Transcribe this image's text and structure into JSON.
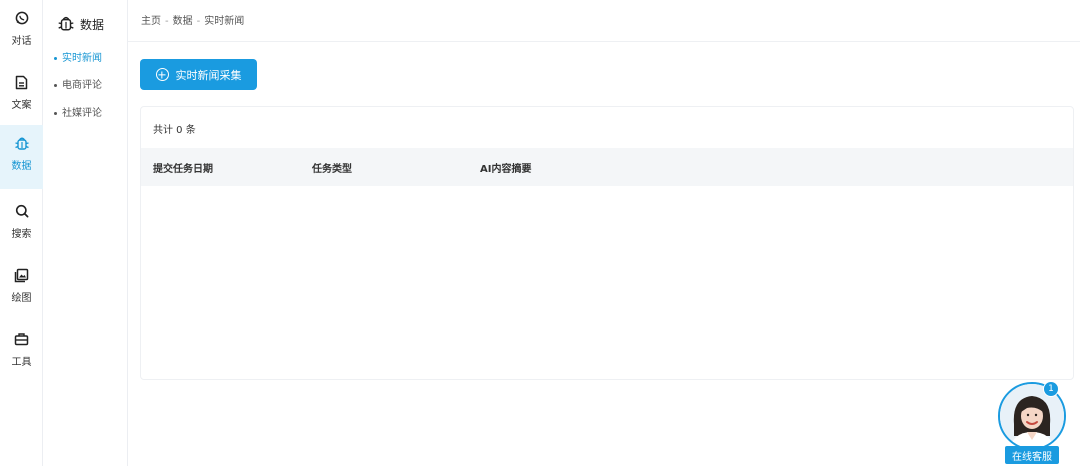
{
  "rail": {
    "items": [
      {
        "label": "对话",
        "icon": "chat-icon",
        "active": false
      },
      {
        "label": "文案",
        "icon": "document-icon",
        "active": false
      },
      {
        "label": "数据",
        "icon": "data-bug-icon",
        "active": true
      },
      {
        "label": "搜索",
        "icon": "search-icon",
        "active": false
      },
      {
        "label": "绘图",
        "icon": "image-icon",
        "active": false
      },
      {
        "label": "工具",
        "icon": "toolbox-icon",
        "active": false
      }
    ]
  },
  "submenu": {
    "title": "数据",
    "icon": "data-bug-icon",
    "items": [
      {
        "label": "实时新闻",
        "active": true
      },
      {
        "label": "电商评论",
        "active": false
      },
      {
        "label": "社媒评论",
        "active": false
      }
    ]
  },
  "breadcrumb": {
    "items": [
      "主页",
      "数据",
      "实时新闻"
    ],
    "separator": "-"
  },
  "toolbar": {
    "collect_button_label": "实时新闻采集",
    "collect_button_icon": "plus-circle-icon"
  },
  "table": {
    "count_text": "共计 0 条",
    "columns": [
      "提交任务日期",
      "任务类型",
      "AI内容摘要"
    ],
    "rows": []
  },
  "support": {
    "label": "在线客服",
    "badge_count": "1"
  },
  "colors": {
    "accent": "#1a9be0",
    "active_bg": "#e6f4fb",
    "table_header_bg": "#f4f6f8"
  }
}
